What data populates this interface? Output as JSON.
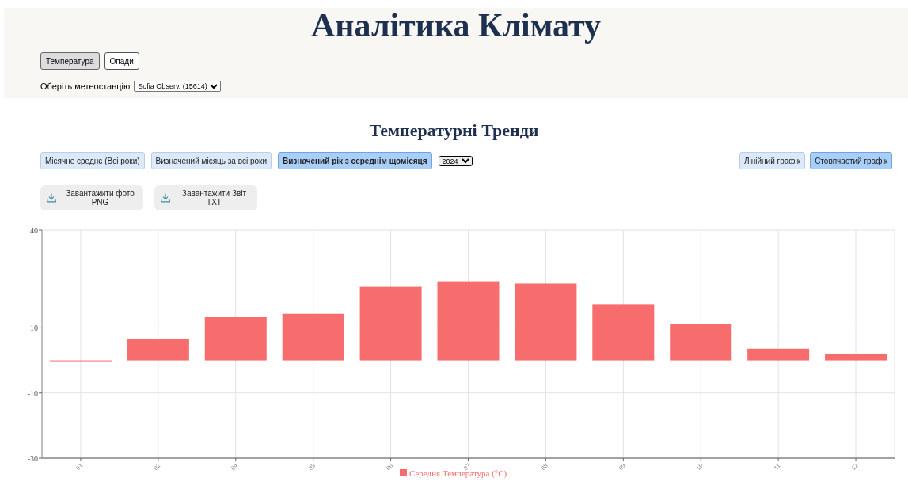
{
  "header": {
    "title": "Аналітика Клімату",
    "tabs": [
      {
        "label": "Температура",
        "selected": true
      },
      {
        "label": "Опади",
        "selected": false
      }
    ],
    "station": {
      "label": "Оберіть метеостанцію:",
      "value": "Sofia Observ. (15614)"
    }
  },
  "section_title": "Температурні Тренди",
  "modes": [
    {
      "label": "Місячне среднє (Всі роки)",
      "selected": false
    },
    {
      "label": "Визначений місяць за всі роки",
      "selected": false
    },
    {
      "label": "Визначений рік з середнім щомісяця",
      "selected": true
    }
  ],
  "year_select": "2024",
  "chart_types": [
    {
      "label": "Лінійний графік",
      "selected": false
    },
    {
      "label": "Стовпчастий графік",
      "selected": true
    }
  ],
  "downloads": [
    {
      "line1": "Завантажити фото",
      "line2": "PNG"
    },
    {
      "line1": "Завантажити Звіт",
      "line2": "TXT"
    }
  ],
  "chart_data": {
    "type": "bar",
    "categories": [
      "01",
      "02",
      "04",
      "05",
      "06",
      "07",
      "08",
      "09",
      "10",
      "11",
      "12"
    ],
    "series": [
      {
        "name": "Середня Температура (°C)",
        "color": "#f76c6c",
        "values": [
          -0.1,
          6.6,
          13.4,
          14.3,
          22.6,
          24.3,
          23.6,
          17.3,
          11.2,
          3.6,
          1.9
        ]
      }
    ],
    "ylim": [
      -30,
      40
    ],
    "yticks": [
      40,
      10,
      -10,
      -30
    ],
    "grid": true
  }
}
